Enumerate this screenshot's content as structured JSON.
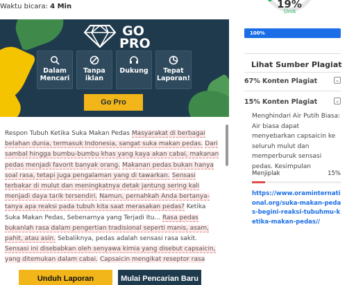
{
  "reading_time": {
    "label": "Waktu bicara:",
    "value": "4 Min"
  },
  "promo": {
    "title_line1": "GO",
    "title_line2": "PRO",
    "features": [
      {
        "label": "Dalam Mencari",
        "icon": "search-icon"
      },
      {
        "label": "Tanpa iklan",
        "icon": "no-ads-icon"
      },
      {
        "label": "Dukung",
        "icon": "headset-icon"
      },
      {
        "label": "Tepat Laporan!",
        "icon": "pie-chart-icon"
      }
    ],
    "button": "Go Pro"
  },
  "text": {
    "segments": [
      {
        "t": "Respon Tubuh Ketika Suka Makan Pedas ",
        "hl": false
      },
      {
        "t": "Masyarakat di berbagai belahan dunia, termasuk Indonesia, sangat suka makan pedas.",
        "hl": true
      },
      {
        "t": " ",
        "hl": false
      },
      {
        "t": "Dari sambal hingga bumbu-bumbu khas yang kaya akan cabai, makanan pedas menjadi favorit banyak orang.",
        "hl": true
      },
      {
        "t": " ",
        "hl": false
      },
      {
        "t": "Makanan pedas bukan hanya soal rasa, tetapi juga pengalaman yang di tawarkan.",
        "hl": true
      },
      {
        "t": " ",
        "hl": false
      },
      {
        "t": "Sensasi terbakar di mulut dan meningkatnya detak jantung sering kali menjadi daya tarik tersendiri.",
        "hl": true
      },
      {
        "t": " ",
        "hl": false
      },
      {
        "t": "Namun, pernahkah Anda bertanya-tanya apa reaksi pada tubuh kita saat merasakan pedas?",
        "hl": true
      },
      {
        "t": " Ketika Suka Makan Pedas, Sebenarnya yang Terjadi Itu... ",
        "hl": false
      },
      {
        "t": "Rasa pedas bukanlah rasa dalam pengertian tradisional seperti manis, asam, pahit, atau asin.",
        "hl": true
      },
      {
        "t": " Sebaliknya, pedas adalah sensasi rasa sakit. ",
        "hl": false
      },
      {
        "t": "Sensasi ini disebabkan oleh senyawa kimia yang disebut capsaicin, yang ditemukan dalam cabai.",
        "hl": true
      },
      {
        "t": " ",
        "hl": false
      },
      {
        "t": "Capsaicin mengikat reseptor rasa sakit di mulut, yang disebut reseptor",
        "hl": true
      }
    ]
  },
  "actions": {
    "download": "Unduh Laporan",
    "new_search": "Mulai Pencarian Baru"
  },
  "score": {
    "percent": "19%",
    "label": "Unik",
    "progress_label": "100%",
    "progress": 1.0,
    "unique_fraction": 0.19
  },
  "sources": {
    "title": "Lihat Sumber Plagiat",
    "items": [
      {
        "label": "67% Konten Plagiat"
      },
      {
        "label": "15% Konten Plagiat"
      }
    ],
    "detail": {
      "text": "Menghindari Air Putih Biasa: Air biasa dapat menyebarkan capsaicin ke seluruh mulut dan memperburuk sensasi pedas. Kesimpulan",
      "metric_label": "Menjiplak",
      "metric_value": "15%",
      "metric_fraction": 0.15,
      "url": "https://www.oraminternational.org/suka-makan-pedas-begini-reaksi-tubuhmu-ketika-makan-pedas//"
    }
  },
  "colors": {
    "accent": "#f2b61a",
    "navy": "#1f3a4d",
    "blue": "#1b6ee6",
    "green": "#2bb56a",
    "red": "#e04a4a"
  }
}
